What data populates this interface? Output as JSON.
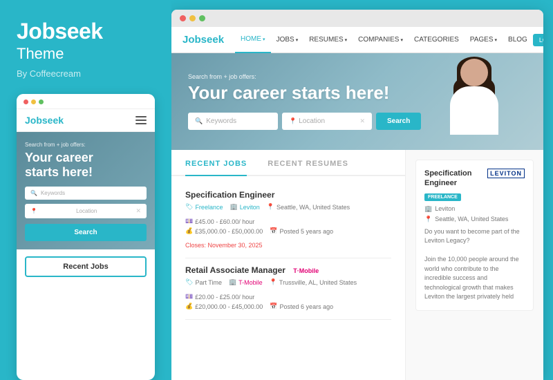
{
  "left": {
    "brand_title": "Jobseek",
    "brand_subtitle": "Theme",
    "brand_by": "By Coffeecream",
    "mobile_preview": {
      "nav_brand": "Jobseek",
      "hero_subtitle": "Search from + job offers:",
      "hero_title": "Your career starts here!",
      "search_placeholder": "Keywords",
      "location_placeholder": "Location",
      "search_btn": "Search",
      "recent_jobs_btn": "Recent Jobs"
    }
  },
  "right": {
    "nav": {
      "brand": "Jobseek",
      "links": [
        {
          "label": "HOME",
          "caret": true,
          "active": true
        },
        {
          "label": "JOBS",
          "caret": true,
          "active": false
        },
        {
          "label": "RESUMES",
          "caret": true,
          "active": false
        },
        {
          "label": "COMPANIES",
          "caret": true,
          "active": false
        },
        {
          "label": "CATEGORIES",
          "caret": false,
          "active": false
        },
        {
          "label": "PAGES",
          "caret": true,
          "active": false
        },
        {
          "label": "BLOG",
          "caret": false,
          "active": false
        }
      ],
      "login_btn": "LOG IN / SIGN UP"
    },
    "hero": {
      "subtitle": "Search from + job offers:",
      "title": "Your career starts here!",
      "search_placeholder": "Keywords",
      "location_placeholder": "Location",
      "search_btn": "Search"
    },
    "tabs": [
      {
        "label": "RECENT JOBS",
        "active": true
      },
      {
        "label": "RECENT RESUMES",
        "active": false
      }
    ],
    "jobs": [
      {
        "title": "Specification Engineer",
        "meta1_type": "Freelance",
        "meta1_company": "Leviton",
        "meta1_location": "Seattle, WA, United States",
        "meta1_salary": "£45.00 - £60.00/ hour",
        "meta2_salary_range": "£35,000.00 - £50,000.00",
        "meta2_posted": "Posted 5 years ago",
        "meta2_closes": "Closes: November 30, 2025"
      },
      {
        "title": "Retail Associate Manager",
        "meta1_type": "Part Time",
        "meta1_company": "T-Mobile",
        "meta1_location": "Trussville, AL, United States",
        "meta1_salary": "£20.00 - £25.00/ hour",
        "meta2_salary_range": "£20,000.00 - £45,000.00",
        "meta2_posted": "Posted 6 years ago",
        "meta2_closes": ""
      }
    ],
    "sidebar": {
      "job_title": "Specification Engineer",
      "badge": "FREELANCE",
      "company": "Leviton",
      "location": "Seattle, WA, United States",
      "description": "Do you want to become part of the Leviton Legacy?\n\nJoin the 10,000 people around the world who contribute to the incredible success and technological growth that makes Leviton the largest privately held"
    }
  }
}
